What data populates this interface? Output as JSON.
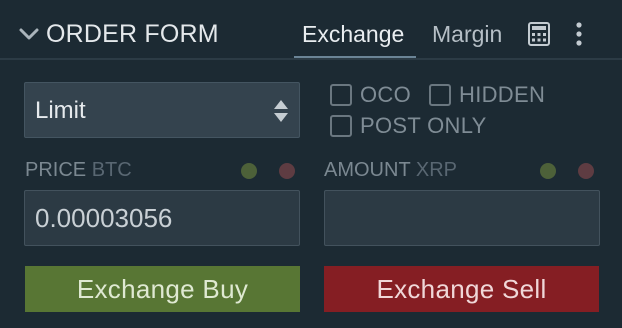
{
  "header": {
    "title": "ORDER FORM",
    "tabs": [
      {
        "label": "Exchange",
        "active": true
      },
      {
        "label": "Margin",
        "active": false
      }
    ],
    "icons": [
      "chevron-down-icon",
      "calculator-icon",
      "more-vertical-icon"
    ]
  },
  "order_type": {
    "selected": "Limit",
    "icon": "up-down-arrows-icon"
  },
  "options": {
    "oco": {
      "label": "OCO",
      "checked": false
    },
    "hidden": {
      "label": "HIDDEN",
      "checked": false
    },
    "post_only": {
      "label": "POST ONLY",
      "checked": false
    }
  },
  "price": {
    "label": "PRICE",
    "currency": "BTC",
    "value": "0.00003056"
  },
  "amount": {
    "label": "AMOUNT",
    "currency": "XRP",
    "value": ""
  },
  "actions": {
    "buy_label": "Exchange Buy",
    "sell_label": "Exchange Sell"
  },
  "colors": {
    "background": "#1c2a33",
    "buy": "#587634",
    "sell": "#851e23",
    "indicator_green": "#4d6139",
    "indicator_red": "#5e3c42"
  }
}
